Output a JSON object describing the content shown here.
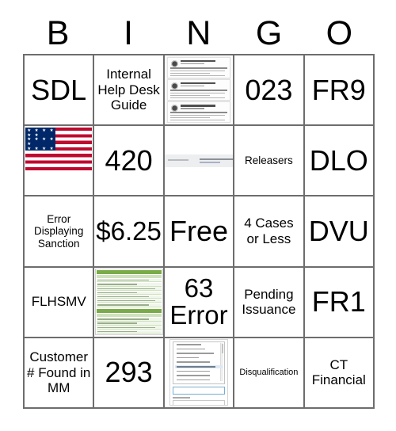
{
  "card": {
    "title": "BINGO",
    "header_letters": [
      "B",
      "I",
      "N",
      "G",
      "O"
    ],
    "grid": {
      "rows": 5,
      "columns": 5,
      "border_color": "#6d6d6d",
      "background": "#ffffff"
    },
    "cells": [
      {
        "col": "B",
        "row": 1,
        "text": "SDL",
        "type": "text"
      },
      {
        "col": "I",
        "row": 1,
        "text": "Internal Help Desk Guide",
        "type": "text"
      },
      {
        "col": "N",
        "row": 1,
        "text": "",
        "type": "image",
        "image": "stacked-certificate-documents"
      },
      {
        "col": "G",
        "row": 1,
        "text": "023",
        "type": "text"
      },
      {
        "col": "O",
        "row": 1,
        "text": "FR9",
        "type": "text"
      },
      {
        "col": "B",
        "row": 2,
        "text": "",
        "type": "image",
        "image": "us-flag"
      },
      {
        "col": "I",
        "row": 2,
        "text": "420",
        "type": "text"
      },
      {
        "col": "N",
        "row": 2,
        "text": "",
        "type": "image",
        "image": "screenshot-message-bar"
      },
      {
        "col": "G",
        "row": 2,
        "text": "Releasers",
        "type": "text"
      },
      {
        "col": "O",
        "row": 2,
        "text": "DLO",
        "type": "text"
      },
      {
        "col": "B",
        "row": 3,
        "text": "Error Displaying Sanction",
        "type": "text"
      },
      {
        "col": "I",
        "row": 3,
        "text": "$6.25",
        "type": "text"
      },
      {
        "col": "N",
        "row": 3,
        "text": "Free",
        "type": "text"
      },
      {
        "col": "G",
        "row": 3,
        "text": "4 Cases or Less",
        "type": "text"
      },
      {
        "col": "O",
        "row": 3,
        "text": "DVU",
        "type": "text"
      },
      {
        "col": "B",
        "row": 4,
        "text": "FLHSMV",
        "type": "text"
      },
      {
        "col": "I",
        "row": 4,
        "text": "",
        "type": "image",
        "image": "green-banded-transaction-table"
      },
      {
        "col": "N",
        "row": 4,
        "text": "63 Error",
        "type": "text"
      },
      {
        "col": "G",
        "row": 4,
        "text": "Pending Issuance",
        "type": "text"
      },
      {
        "col": "O",
        "row": 4,
        "text": "FR1",
        "type": "text"
      },
      {
        "col": "B",
        "row": 5,
        "text": "Customer # Found in MM",
        "type": "text"
      },
      {
        "col": "I",
        "row": 5,
        "text": "293",
        "type": "text"
      },
      {
        "col": "N",
        "row": 5,
        "text": "",
        "type": "image",
        "image": "dropdown-form-screenshot"
      },
      {
        "col": "G",
        "row": 5,
        "text": "Disqualification",
        "type": "text"
      },
      {
        "col": "O",
        "row": 5,
        "text": "CT Financial",
        "type": "text"
      }
    ]
  },
  "colors": {
    "flag_red": "#bf0a30",
    "flag_blue": "#002868",
    "table_green": "#7aab49",
    "grid_border": "#6d6d6d",
    "text": "#000000"
  }
}
